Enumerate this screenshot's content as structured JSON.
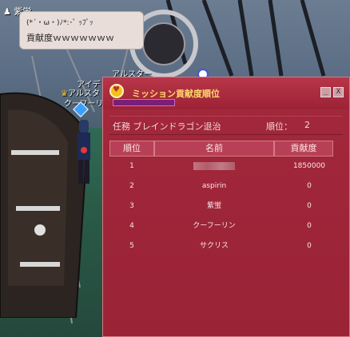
{
  "chat": {
    "player": "紫蛍",
    "line1": "(*´・ω・)ﾉ*:･ﾟ ｯﾌﾟｯ",
    "line2": "貢献度ｗｗｗｗｗｗｗ"
  },
  "world_labels": {
    "top_name": "アルスター",
    "guild": "アイデ",
    "name_a": "アルスタ",
    "name_b": "クーフーリ"
  },
  "window": {
    "title": "ミッション貢献度順位",
    "minimize": "_",
    "close": "X",
    "mission_name": "任務 ブレインドラゴン退治",
    "rank_label": "順位：",
    "rank_value": "2",
    "headers": {
      "rank": "順位",
      "name": "名前",
      "points": "貢献度"
    },
    "rows": [
      {
        "rank": "1",
        "name": "",
        "points": "1850000"
      },
      {
        "rank": "2",
        "name": "aspirin",
        "points": "0"
      },
      {
        "rank": "3",
        "name": "紫蛍",
        "points": "0"
      },
      {
        "rank": "4",
        "name": "クーフーリン",
        "points": "0"
      },
      {
        "rank": "5",
        "name": "サクリス",
        "points": "0"
      }
    ]
  },
  "colors": {
    "window_bg": "#a3283c",
    "title_text": "#ffd86a",
    "header_bg": "#b84056"
  }
}
